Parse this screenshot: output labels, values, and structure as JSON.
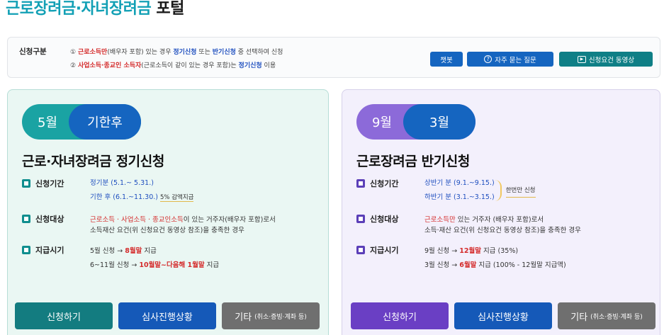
{
  "page": {
    "title_accent": "근로장려금·자녀장려금",
    "title_rest": " 포털"
  },
  "info": {
    "label": "신청구분",
    "line1": {
      "prefix": "① ",
      "red": "근로소득만",
      "mid1": "(배우자 포함) 있는 경우 ",
      "blue1": "정기신청",
      "mid2": " 또는 ",
      "blue2": "반기신청",
      "suffix": " 중 선택하여 신청"
    },
    "line2": {
      "prefix": "② ",
      "red": "사업소득·종교인 소득자",
      "mid": "(근로소득이 같이 있는 경우 포함)는 ",
      "blue": "정기신청",
      "suffix": " 이용"
    },
    "buttons": {
      "chatbot": "챗봇",
      "faq": "자주 묻는 질문",
      "video": "신청요건 동영상"
    }
  },
  "left_card": {
    "pill_a": "5월",
    "pill_b": "기한후",
    "title": "근로·자녀장려금 정기신청",
    "period": {
      "label": "신청기간",
      "line1": "정기분 (5.1.~ 5.31.)",
      "line2": "기한 후 (6.1.~11.30.)",
      "line2_note": "5% 감액지급"
    },
    "target": {
      "label": "신청대상",
      "red": "근로소득 · 사업소득 · 종교인소득",
      "rest1": "이 있는 거주자(배우자 포함)로서",
      "line2": "소득재산 요건(위 신청요건 동영상 참조)을 충족한 경우"
    },
    "payment": {
      "label": "지급시기",
      "l1_pre": "5월 신청 → ",
      "l1_red": "8월말",
      "l1_post": " 지급",
      "l2_pre": "6~11월 신청 → ",
      "l2_red": "10월말~다음해 1월말",
      "l2_post": " 지급"
    },
    "buttons": {
      "apply": "신청하기",
      "status": "심사진행상황",
      "etc": "기타",
      "etc_sub": "(취소·증빙·계좌 등)"
    }
  },
  "right_card": {
    "pill_a": "9월",
    "pill_b": "3월",
    "title": "근로장려금 반기신청",
    "period": {
      "label": "신청기간",
      "line1": "상반기 분 (9.1.~9.15.)",
      "line2": "하반기 분 (3.1.~3.15.)",
      "note": "한번만 신청"
    },
    "target": {
      "label": "신청대상",
      "red": "근로소득만",
      "rest1": " 있는 거주자 (배우자 포함)로서",
      "line2": "소득·재산 요건(위 신청요건 동영상 참조)을 충족한 경우"
    },
    "payment": {
      "label": "지급시기",
      "l1_pre": "9월 신청 → ",
      "l1_red": "12월말",
      "l1_post": " 지급 (35%)",
      "l2_pre": "3월 신청 → ",
      "l2_red": "6월말",
      "l2_post": " 지급 (100% - 12월말 지급액)"
    },
    "buttons": {
      "apply": "신청하기",
      "status": "심사진행상황",
      "etc": "기타",
      "etc_sub": "(취소·증빙·계좌 등)"
    }
  }
}
